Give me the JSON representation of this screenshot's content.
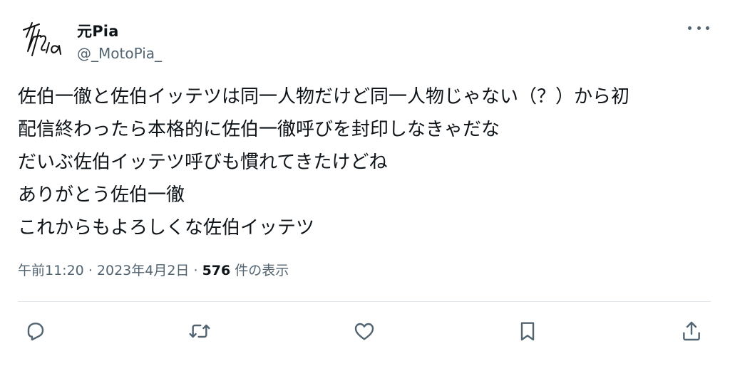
{
  "tweet": {
    "author": {
      "display_name": "元Pia",
      "handle": "@_MotoPia_"
    },
    "lines": [
      "佐伯一徹と佐伯イッテツは同一人物だけど同一人物じゃない（？）から初",
      "配信終わったら本格的に佐伯一徹呼びを封印しなきゃだな",
      "だいぶ佐伯イッテツ呼びも慣れてきたけどね",
      "ありがとう佐伯一徹",
      "これからもよろしくな佐伯イッテツ"
    ],
    "meta": {
      "time": "午前11:20",
      "separator": "·",
      "date": "2023年4月2日",
      "views_count": "576",
      "views_label": "件の表示"
    }
  },
  "icons": {
    "more": "more-horizontal-icon",
    "reply": "reply-icon",
    "retweet": "retweet-icon",
    "like": "like-icon",
    "bookmark": "bookmark-icon",
    "share": "share-icon"
  },
  "colors": {
    "text": "#0f1419",
    "secondary": "#536471",
    "divider": "#e1e6ea"
  }
}
